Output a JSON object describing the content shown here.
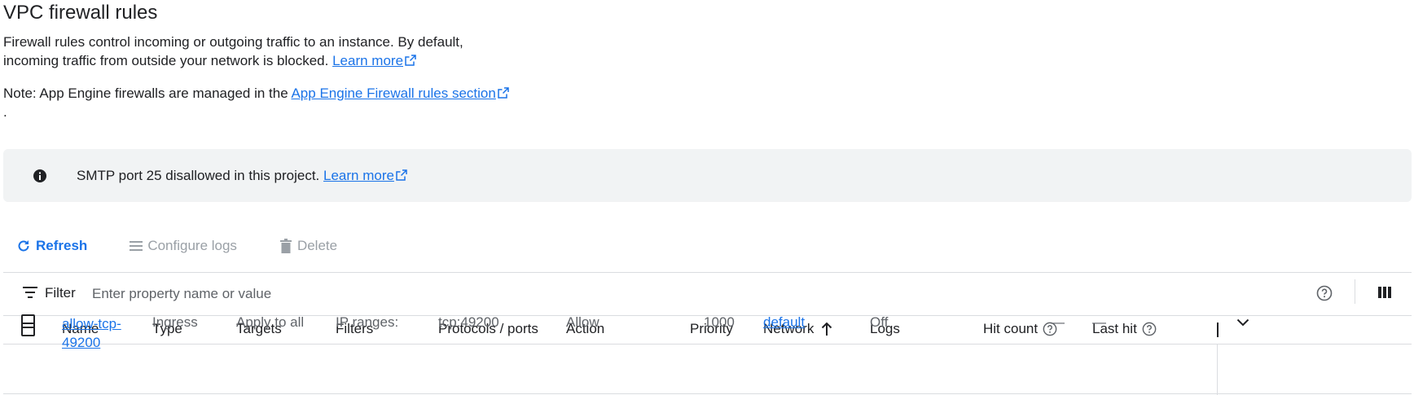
{
  "page": {
    "title": "VPC firewall rules",
    "description_line1": "Firewall rules control incoming or outgoing traffic to an instance. By default,",
    "description_line2": "incoming traffic from outside your network is blocked.",
    "learn_more": "Learn more",
    "note_prefix": "Note: App Engine firewalls are managed in the",
    "note_link": "App Engine Firewall rules section",
    "note_suffix": "."
  },
  "banner": {
    "icon": "info-icon",
    "message": "SMTP port 25 disallowed in this project.",
    "learn_more": "Learn more"
  },
  "toolbar": {
    "refresh": "Refresh",
    "configure_logs": "Configure logs",
    "delete": "Delete"
  },
  "filter": {
    "label": "Filter",
    "placeholder": "Enter property name or value"
  },
  "table": {
    "columns": {
      "name": "Name",
      "type": "Type",
      "targets": "Targets",
      "filters": "Filters",
      "protocols": "Protocols / ports",
      "action": "Action",
      "priority": "Priority",
      "network": "Network",
      "logs": "Logs",
      "hit_count": "Hit count",
      "last_hit": "Last hit"
    },
    "sort": {
      "column": "Network",
      "direction": "ascending"
    },
    "rows": [
      {
        "name_line1": "allow-tcp-",
        "name_line2": "49200",
        "type": "Ingress",
        "targets": "Apply to all",
        "filters": "IP ranges:",
        "protocols": "tcp:49200",
        "action": "Allow",
        "priority": "1000",
        "network": "default",
        "logs": "Off",
        "hit_count": "—",
        "last_hit": "—"
      }
    ]
  },
  "colors": {
    "link": "#1a73e8",
    "banner_bg": "#f1f3f4",
    "disabled": "#9aa0a6",
    "divider": "#dadce0"
  }
}
